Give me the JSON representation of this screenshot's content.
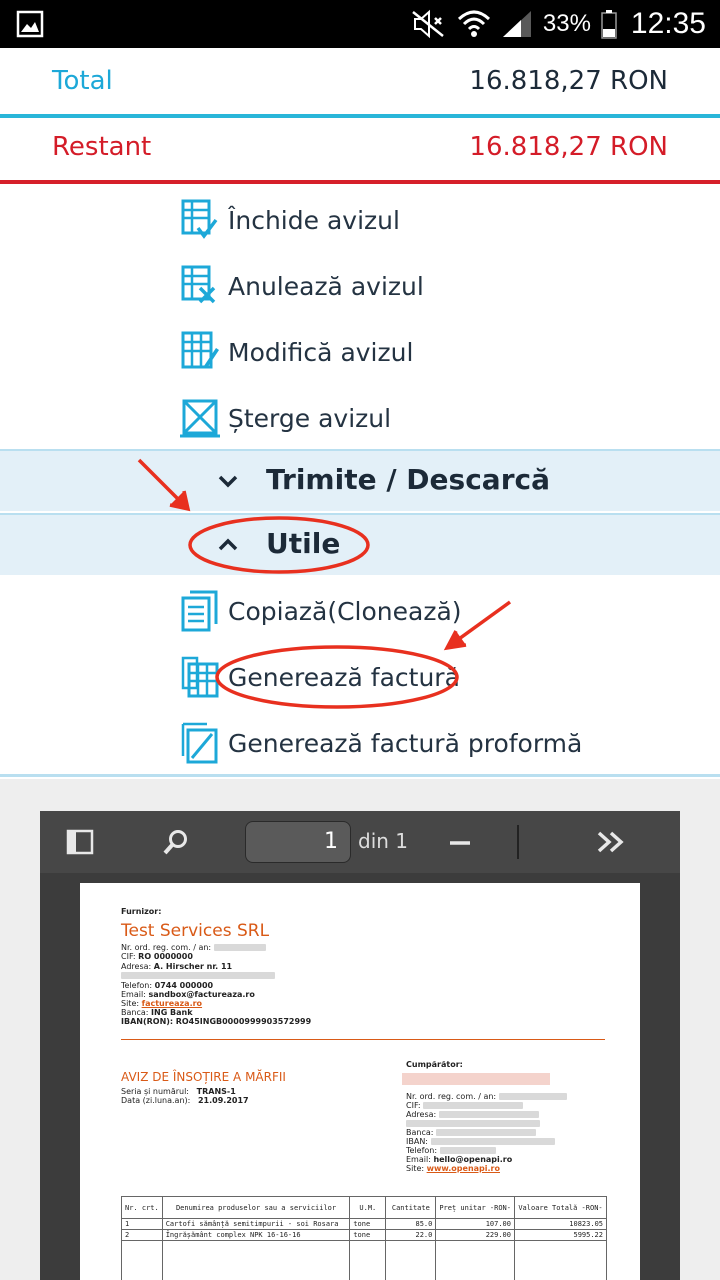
{
  "status_bar": {
    "battery": "33%",
    "time": "12:35"
  },
  "totals": {
    "total_label": "Total",
    "total_value": "16.818,27 RON",
    "rest_label": "Restant",
    "rest_value": "16.818,27 RON"
  },
  "actions": [
    {
      "label": "Închide avizul",
      "icon": "close-notice-icon"
    },
    {
      "label": "Anulează avizul",
      "icon": "cancel-notice-icon"
    },
    {
      "label": "Modifică avizul",
      "icon": "edit-notice-icon"
    },
    {
      "label": "Șterge avizul",
      "icon": "delete-notice-icon"
    }
  ],
  "sections": {
    "send": "Trimite / Descarcă",
    "useful": "Utile"
  },
  "useful_actions": [
    {
      "label": "Copiază(Clonează)",
      "icon": "copy-icon"
    },
    {
      "label": "Generează factură",
      "icon": "generate-invoice-icon"
    },
    {
      "label": "Generează factură proformă",
      "icon": "proforma-icon"
    }
  ],
  "pdf_viewer": {
    "page": "1",
    "of_label": "din 1"
  },
  "document": {
    "supplier_heading": "Furnizor:",
    "supplier_name": "Test Services SRL",
    "reg_label": "Nr. ord. reg. com. / an:",
    "cif_label": "CIF:",
    "cif_value": "RO 0000000",
    "address_label": "Adresa:",
    "address_value": "A. Hirscher nr. 11",
    "phone_label": "Telefon:",
    "phone_value": "0744 000000",
    "email_label": "Email:",
    "email_value": "sandbox@factureaza.ro",
    "site_label": "Site:",
    "site_value": "factureaza.ro",
    "bank_label": "Banca:",
    "bank_value": "ING Bank",
    "iban_label": "IBAN(RON):",
    "iban_value": "RO45INGB0000999903572999",
    "doc_title": "AVIZ DE ÎNSOȚIRE A MĂRFII",
    "series_label": "Seria și numărul:",
    "series_value": "TRANS-1",
    "date_label": "Data (zi.luna.an):",
    "date_value": "21.09.2017",
    "buyer_heading": "Cumpărător:",
    "buyer_reg_label": "Nr. ord. reg. com. / an:",
    "buyer_cif_label": "CIF:",
    "buyer_address_label": "Adresa:",
    "buyer_bank_label": "Banca:",
    "buyer_iban_label": "IBAN:",
    "buyer_phone_label": "Telefon:",
    "buyer_email_label": "Email:",
    "buyer_email_value": "hello@openapi.ro",
    "buyer_site_label": "Site:",
    "buyer_site_value": "www.openapi.ro",
    "table_headers": [
      "Nr. crt.",
      "Denumirea produselor sau a serviciilor",
      "U.M.",
      "Cantitate",
      "Preț unitar -RON-",
      "Valoare Totală -RON-"
    ],
    "rows": [
      [
        "1",
        "Cartofi sămânță semitimpurii - soi Rosara",
        "tone",
        "85.0",
        "107.00",
        "10823.05"
      ],
      [
        "2",
        "Îngrășământ complex NPK 16-16-16",
        "tone",
        "22.0",
        "229.00",
        "5995.22"
      ]
    ]
  }
}
